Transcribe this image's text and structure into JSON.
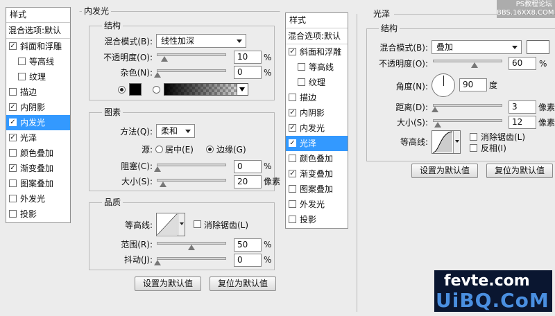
{
  "left_panel": {
    "style_list": {
      "title": "样式",
      "blend_options": "混合选项:默认",
      "items": [
        {
          "label": "斜面和浮雕",
          "checked": true,
          "sub": false,
          "selected": false
        },
        {
          "label": "等高线",
          "checked": false,
          "sub": true,
          "selected": false
        },
        {
          "label": "纹理",
          "checked": false,
          "sub": true,
          "selected": false
        },
        {
          "label": "描边",
          "checked": false,
          "sub": false,
          "selected": false
        },
        {
          "label": "内阴影",
          "checked": true,
          "sub": false,
          "selected": false
        },
        {
          "label": "内发光",
          "checked": true,
          "sub": false,
          "selected": true
        },
        {
          "label": "光泽",
          "checked": true,
          "sub": false,
          "selected": false
        },
        {
          "label": "颜色叠加",
          "checked": false,
          "sub": false,
          "selected": false
        },
        {
          "label": "渐变叠加",
          "checked": true,
          "sub": false,
          "selected": false
        },
        {
          "label": "图案叠加",
          "checked": false,
          "sub": false,
          "selected": false
        },
        {
          "label": "外发光",
          "checked": false,
          "sub": false,
          "selected": false
        },
        {
          "label": "投影",
          "checked": false,
          "sub": false,
          "selected": false
        }
      ]
    },
    "inner_glow": {
      "title": "内发光",
      "structure": {
        "title": "结构",
        "blend_mode_label": "混合模式(B):",
        "blend_mode_value": "线性加深",
        "opacity_label": "不透明度(O):",
        "opacity_value": "10",
        "opacity_unit": "%",
        "opacity_level": 0.1,
        "noise_label": "杂色(N):",
        "noise_value": "0",
        "noise_unit": "%",
        "noise_level": 0.0,
        "color_hex": "#000000"
      },
      "elements": {
        "title": "图素",
        "technique_label": "方法(Q):",
        "technique_value": "柔和",
        "source_label": "源:",
        "source_center": "居中(E)",
        "source_edge": "边缘(G)",
        "choke_label": "阻塞(C):",
        "choke_value": "0",
        "choke_unit": "%",
        "choke_level": 0.0,
        "size_label": "大小(S):",
        "size_value": "20",
        "size_unit": "像素",
        "size_level": 0.08
      },
      "quality": {
        "title": "品质",
        "contour_label": "等高线:",
        "antialias_label": "消除锯齿(L)",
        "range_label": "范围(R):",
        "range_value": "50",
        "range_unit": "%",
        "range_level": 0.5,
        "jitter_label": "抖动(J):",
        "jitter_value": "0",
        "jitter_unit": "%",
        "jitter_level": 0.0
      },
      "make_default": "设置为默认值",
      "reset_default": "复位为默认值"
    }
  },
  "right_panel": {
    "style_list": {
      "title": "样式",
      "blend_options": "混合选项:默认",
      "items": [
        {
          "label": "斜面和浮雕",
          "checked": true,
          "sub": false,
          "selected": false
        },
        {
          "label": "等高线",
          "checked": false,
          "sub": true,
          "selected": false
        },
        {
          "label": "纹理",
          "checked": false,
          "sub": true,
          "selected": false
        },
        {
          "label": "描边",
          "checked": false,
          "sub": false,
          "selected": false
        },
        {
          "label": "内阴影",
          "checked": true,
          "sub": false,
          "selected": false
        },
        {
          "label": "内发光",
          "checked": true,
          "sub": false,
          "selected": false
        },
        {
          "label": "光泽",
          "checked": true,
          "sub": false,
          "selected": true
        },
        {
          "label": "颜色叠加",
          "checked": false,
          "sub": false,
          "selected": false
        },
        {
          "label": "渐变叠加",
          "checked": true,
          "sub": false,
          "selected": false
        },
        {
          "label": "图案叠加",
          "checked": false,
          "sub": false,
          "selected": false
        },
        {
          "label": "外发光",
          "checked": false,
          "sub": false,
          "selected": false
        },
        {
          "label": "投影",
          "checked": false,
          "sub": false,
          "selected": false
        }
      ]
    },
    "satin": {
      "title": "光泽",
      "structure_title": "结构",
      "blend_mode_label": "混合模式(B):",
      "blend_mode_value": "叠加",
      "color_hex": "#ffffff",
      "opacity_label": "不透明度(O):",
      "opacity_value": "60",
      "opacity_unit": "%",
      "opacity_level": 0.6,
      "angle_label": "角度(N):",
      "angle_value": "90",
      "angle_unit": "度",
      "distance_label": "距离(D):",
      "distance_value": "3",
      "distance_unit": "像素",
      "distance_level": 0.02,
      "size_label": "大小(S):",
      "size_value": "12",
      "size_unit": "像素",
      "size_level": 0.06,
      "contour_label": "等高线:",
      "antialias_label": "消除锯齿(L)",
      "invert_label": "反相(I)",
      "make_default": "设置为默认值",
      "reset_default": "复位为默认值"
    }
  },
  "watermark": {
    "top_line1": "PS教程论坛",
    "top_line2": "BBS.16XX8.COM",
    "brand_top": "fevte.com",
    "brand_bottom": "UiBQ.CoM"
  }
}
